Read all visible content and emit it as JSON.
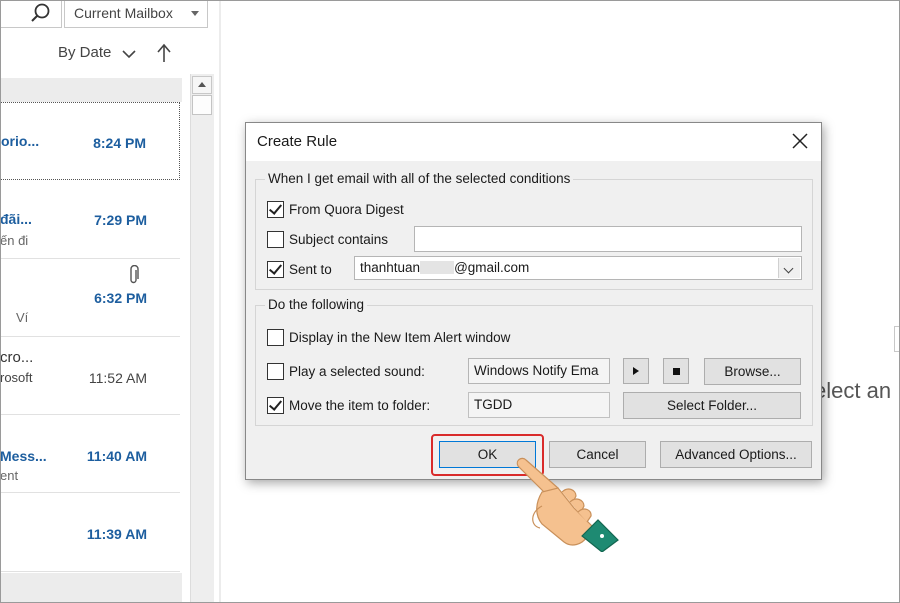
{
  "app": {
    "search_scope": "Current Mailbox",
    "sort_label": "By Date",
    "reading_pane_text": "elect an"
  },
  "mail_list": [
    {
      "sender": "orio...",
      "preview": "",
      "time": "8:24 PM",
      "unread": true,
      "selected": true,
      "attachment": false
    },
    {
      "sender": "đãi...",
      "preview": "ến đi",
      "time": "7:29 PM",
      "unread": true,
      "selected": false,
      "attachment": false
    },
    {
      "sender": "",
      "preview": "Ví",
      "time": "6:32 PM",
      "unread": true,
      "selected": false,
      "attachment": true
    },
    {
      "sender": "cro...",
      "preview": "rosoft",
      "time": "11:52 AM",
      "unread": false,
      "selected": false,
      "attachment": false
    },
    {
      "sender": "Mess...",
      "preview": "ent",
      "time": "11:40 AM",
      "unread": true,
      "selected": false,
      "attachment": false
    },
    {
      "sender": "",
      "preview": "",
      "time": "11:39 AM",
      "unread": true,
      "selected": false,
      "attachment": false
    }
  ],
  "dialog": {
    "title": "Create Rule",
    "conditions_group": "When I get email with all of the selected conditions",
    "cond_from": {
      "label": "From Quora Digest",
      "checked": true
    },
    "cond_subject": {
      "label": "Subject contains",
      "checked": false,
      "value": ""
    },
    "cond_sent": {
      "label": "Sent to",
      "checked": true,
      "value_prefix": "thanhtuan",
      "value_suffix": "@gmail.com"
    },
    "actions_group": "Do the following",
    "act_alert": {
      "label": "Display in the New Item Alert window",
      "checked": false
    },
    "act_sound": {
      "label": "Play a selected sound:",
      "checked": false,
      "value": "Windows Notify Ema",
      "browse_label": "Browse..."
    },
    "act_move": {
      "label": "Move the item to folder:",
      "checked": true,
      "value": "TGDD",
      "select_label": "Select Folder..."
    },
    "ok_label": "OK",
    "cancel_label": "Cancel",
    "advanced_label": "Advanced Options..."
  },
  "colors": {
    "accent": "#1d5e9f",
    "highlight": "#d92b2b",
    "hand_skin": "#f5c18f",
    "hand_cuff": "#1e8a72"
  },
  "icons": [
    "search-icon",
    "chevron-down-icon",
    "sort-arrow-icon",
    "paperclip-icon",
    "close-icon",
    "play-icon",
    "stop-icon",
    "pointing-hand-icon"
  ]
}
